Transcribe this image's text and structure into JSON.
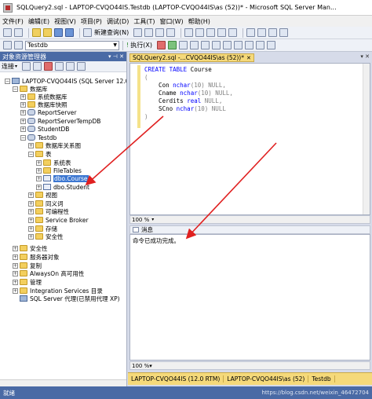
{
  "window": {
    "title": "SQLQuery2.sql - LAPTOP-CVQO44IS.Testdb (LAPTOP-CVQO44IS\\as (52))* - Microsoft SQL Server Man..."
  },
  "menu": [
    "文件(F)",
    "编辑(E)",
    "视图(V)",
    "项目(P)",
    "调试(D)",
    "工具(T)",
    "窗口(W)",
    "帮助(H)"
  ],
  "toolbar": {
    "new_query_label": "新建查询(N)",
    "database": "Testdb",
    "execute_label": "执行(X)"
  },
  "object_explorer": {
    "title": "对象资源管理器",
    "connect_label": "连接",
    "tree": [
      {
        "label": "LAPTOP-CVQO44IS (SQL Server 12.0...",
        "icon": "server-icon",
        "level": 0,
        "expander": "−"
      },
      {
        "label": "数据库",
        "icon": "folder-icon",
        "level": 1,
        "expander": "−"
      },
      {
        "label": "系统数据库",
        "icon": "folder-icon",
        "level": 2,
        "expander": "+"
      },
      {
        "label": "数据库快照",
        "icon": "folder-icon",
        "level": 2,
        "expander": "+"
      },
      {
        "label": "ReportServer",
        "icon": "database-icon",
        "level": 2,
        "expander": "+"
      },
      {
        "label": "ReportServerTempDB",
        "icon": "database-icon",
        "level": 2,
        "expander": "+"
      },
      {
        "label": "StudentDB",
        "icon": "database-icon",
        "level": 2,
        "expander": "+"
      },
      {
        "label": "Testdb",
        "icon": "database-icon",
        "level": 2,
        "expander": "−"
      },
      {
        "label": "数据库关系图",
        "icon": "folder-icon",
        "level": 3,
        "expander": "+"
      },
      {
        "label": "表",
        "icon": "folder-icon",
        "level": 3,
        "expander": "−"
      },
      {
        "label": "系统表",
        "icon": "folder-icon",
        "level": 4,
        "expander": "+"
      },
      {
        "label": "FileTables",
        "icon": "folder-icon",
        "level": 4,
        "expander": "+"
      },
      {
        "label": "dbo.Course",
        "icon": "table-icon",
        "level": 4,
        "expander": "+",
        "selected": true
      },
      {
        "label": "dbo.Student",
        "icon": "table-icon",
        "level": 4,
        "expander": "+"
      },
      {
        "label": "视图",
        "icon": "folder-icon",
        "level": 3,
        "expander": "+"
      },
      {
        "label": "同义词",
        "icon": "folder-icon",
        "level": 3,
        "expander": "+"
      },
      {
        "label": "可编程性",
        "icon": "folder-icon",
        "level": 3,
        "expander": "+"
      },
      {
        "label": "Service Broker",
        "icon": "folder-icon",
        "level": 3,
        "expander": "+"
      },
      {
        "label": "存储",
        "icon": "folder-icon",
        "level": 3,
        "expander": "+"
      },
      {
        "label": "安全性",
        "icon": "folder-icon",
        "level": 3,
        "expander": "+"
      },
      {
        "label": "安全性",
        "icon": "folder-icon",
        "level": 1,
        "expander": "+"
      },
      {
        "label": "服务器对象",
        "icon": "folder-icon",
        "level": 1,
        "expander": "+"
      },
      {
        "label": "复制",
        "icon": "folder-icon",
        "level": 1,
        "expander": "+"
      },
      {
        "label": "AlwaysOn 高可用性",
        "icon": "folder-icon",
        "level": 1,
        "expander": "+"
      },
      {
        "label": "管理",
        "icon": "folder-icon",
        "level": 1,
        "expander": "+"
      },
      {
        "label": "Integration Services 目录",
        "icon": "folder-icon",
        "level": 1,
        "expander": "+"
      },
      {
        "label": "SQL Server 代理(已禁用代理 XP)",
        "icon": "agent-icon",
        "level": 1,
        "expander": ""
      }
    ]
  },
  "editor": {
    "tab_label": "SQLQuery2.sql -...CVQO44IS\\as (52))*",
    "code_lines": [
      [
        {
          "t": "CREATE TABLE",
          "c": "kw"
        },
        {
          "t": " Course",
          "c": ""
        }
      ],
      [
        {
          "t": "(",
          "c": "gy"
        }
      ],
      [
        {
          "t": "    Con ",
          "c": ""
        },
        {
          "t": "nchar",
          "c": "ty"
        },
        {
          "t": "(10) NULL,",
          "c": "gy"
        }
      ],
      [
        {
          "t": "    Cname ",
          "c": ""
        },
        {
          "t": "nchar",
          "c": "ty"
        },
        {
          "t": "(10) NULL,",
          "c": "gy"
        }
      ],
      [
        {
          "t": "    Cerdits ",
          "c": ""
        },
        {
          "t": "real",
          "c": "ty"
        },
        {
          "t": " NULL,",
          "c": "gy"
        }
      ],
      [
        {
          "t": "    SCno ",
          "c": ""
        },
        {
          "t": "nchar",
          "c": "ty"
        },
        {
          "t": "(10) NULL",
          "c": "gy"
        }
      ],
      [
        {
          "t": ")",
          "c": "gy"
        }
      ]
    ],
    "zoom": "100 %"
  },
  "results": {
    "tab_label": "消息",
    "message": "命令已成功完成。",
    "zoom": "100 %"
  },
  "query_status": {
    "server": "LAPTOP-CVQO44IS (12.0 RTM)",
    "login": "LAPTOP-CVQO44IS\\as (52)",
    "database": "Testdb"
  },
  "statusbar": {
    "text": "就绪",
    "watermark": "https://blog.csdn.net/weixin_46472704"
  },
  "colors": {
    "annotation_arrow": "#e02020",
    "selection": "#3c77d1",
    "tab_active": "#f5d97a"
  }
}
